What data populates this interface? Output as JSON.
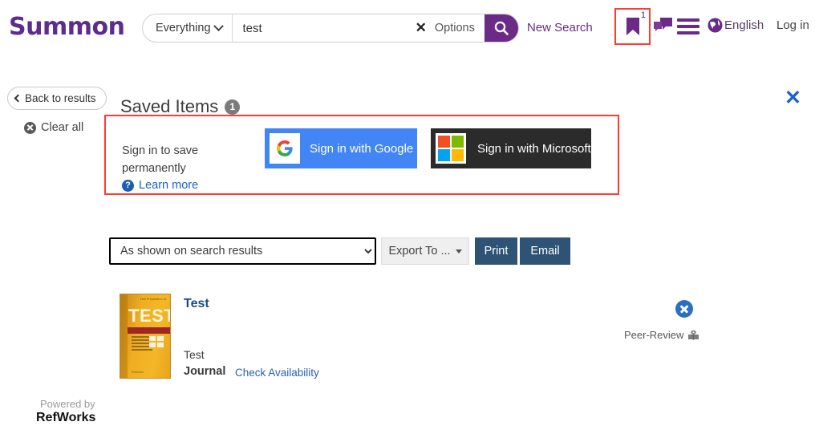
{
  "header": {
    "logo": "Summon",
    "search": {
      "scope_label": "Everything",
      "scope_icon": "chevron-down-icon",
      "query_value": "test",
      "query_placeholder": "",
      "clear_icon": "close-x-icon",
      "options_label": "Options",
      "search_icon": "search-icon"
    },
    "new_search_label": "New Search",
    "saved_icon": "bookmark-icon",
    "saved_count": "1",
    "chat_icon": "chat-bubbles-icon",
    "menu_icon": "hamburger-menu-icon",
    "globe_icon": "globe-icon",
    "language_label": "English",
    "login_label": "Log in"
  },
  "sidebar": {
    "back_label": "Back to results",
    "back_icon": "chevron-left-icon",
    "clear_all_label": "Clear all",
    "clear_all_icon": "x-circle-icon",
    "powered_by_label": "Powered by",
    "powered_by_name": "RefWorks"
  },
  "main": {
    "title": "Saved Items",
    "title_count": "1",
    "close_icon": "close-x-icon",
    "close_label": "✕",
    "signin": {
      "prompt": "Sign in to save permanently",
      "learn_more_label": "Learn more",
      "learn_more_icon": "question-circle-icon",
      "google_label": "Sign in with Google",
      "google_icon": "google-g-icon",
      "microsoft_label": "Sign in with Microsoft",
      "microsoft_icon": "microsoft-squares-icon"
    },
    "toolbar": {
      "sort_selected": "As shown on search results",
      "sort_options": [
        "As shown on search results"
      ],
      "export_label": "Export To ...",
      "export_icon": "caret-down-icon",
      "print_label": "Print",
      "email_label": "Email"
    },
    "results": [
      {
        "cover_text": "TEST",
        "cover_header": "Test Preparation #1",
        "cover_footer": "Publisher",
        "title": "Test",
        "subtitle": "Test",
        "format": "Journal",
        "availability_label": "Check Availability",
        "remove_icon": "x-circle-icon",
        "peer_review_label": "Peer-Review",
        "peer_review_icon": "peer-review-book-icon"
      }
    ]
  },
  "colors": {
    "brand_purple": "#6b2a86",
    "highlight_red": "#ff3b30",
    "link_blue": "#1b62c4",
    "button_slate": "#2e5375",
    "google_blue": "#4285f4",
    "microsoft_black": "#2b2b2b"
  }
}
